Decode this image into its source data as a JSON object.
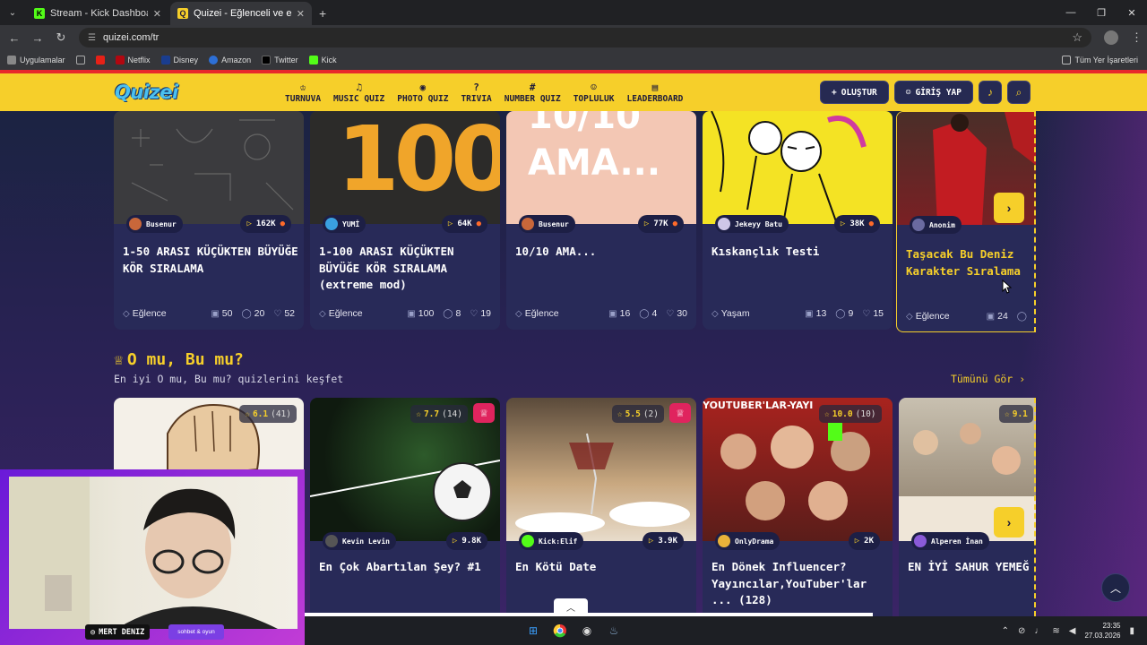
{
  "browser": {
    "tabs": [
      {
        "title": "Stream - Kick Dashboard",
        "active": false
      },
      {
        "title": "Quizei - Eğlenceli ve etkileşimli",
        "active": true
      }
    ],
    "url": "quizei.com/tr",
    "bookmarks": [
      "Uygulamalar",
      "Netflix",
      "Disney",
      "Amazon",
      "Twitter",
      "Kick"
    ],
    "bookmarks_right": "Tüm Yer İşaretleri"
  },
  "site": {
    "logo": "Quizei",
    "nav": [
      {
        "label": "TURNUVA",
        "icon": "trophy-icon",
        "glyph": "♔"
      },
      {
        "label": "MUSIC QUIZ",
        "icon": "music-icon",
        "glyph": "♫"
      },
      {
        "label": "PHOTO QUIZ",
        "icon": "camera-icon",
        "glyph": "◉"
      },
      {
        "label": "TRIVIA",
        "icon": "question-icon",
        "glyph": "?"
      },
      {
        "label": "NUMBER QUIZ",
        "icon": "hash-icon",
        "glyph": "#"
      },
      {
        "label": "TOPLULUK",
        "icon": "users-icon",
        "glyph": "☺"
      },
      {
        "label": "LEADERBOARD",
        "icon": "chart-icon",
        "glyph": "▤"
      }
    ],
    "create_label": "OLUŞTUR",
    "login_label": "GİRİŞ YAP"
  },
  "row1": [
    {
      "author": "Busenur",
      "plays": "162K",
      "title": "1-50 ARASI KÜÇÜKTEN BÜYÜĞE KÖR SIRALAMA",
      "category": "Eğlence",
      "questions": "50",
      "comments": "20",
      "likes": "52"
    },
    {
      "author": "YUMİ",
      "plays": "64K",
      "title": "1-100 ARASI KÜÇÜKTEN BÜYÜĞE KÖR SIRALAMA (extreme mod)",
      "category": "Eğlence",
      "questions": "100",
      "comments": "8",
      "likes": "19",
      "thumb_text": "100"
    },
    {
      "author": "Busenur",
      "plays": "77K",
      "title": "10/10 AMA...",
      "category": "Eğlence",
      "questions": "16",
      "comments": "4",
      "likes": "30",
      "thumb_text": "10/10 AMA..."
    },
    {
      "author": "Jekeyy Batu",
      "plays": "38K",
      "title": "Kıskançlık Testi",
      "category": "Yaşam",
      "questions": "13",
      "comments": "9",
      "likes": "15"
    },
    {
      "author": "Anonim",
      "title": "Taşacak Bu Deniz Karakter Sıralama",
      "category": "Eğlence",
      "questions": "24"
    }
  ],
  "section": {
    "title": "O mu, Bu mu?",
    "subtitle": "En iyi O mu, Bu mu? quizlerini keşfet",
    "see_all": "Tümünü Gör"
  },
  "row2": [
    {
      "rating": "6.1",
      "count": "(41)",
      "author": "",
      "plays": "",
      "title": ""
    },
    {
      "rating": "7.7",
      "count": "(14)",
      "author": "Kevin Levin",
      "plays": "9.8K",
      "title": "En Çok Abartılan Şey? #1"
    },
    {
      "rating": "5.5",
      "count": "(2)",
      "author": "Kick:Elif",
      "plays": "3.9K",
      "title": "En Kötü Date"
    },
    {
      "rating": "10.0",
      "count": "(10)",
      "author": "OnlyDrama",
      "plays": "2K",
      "title": "En Dönek Influencer? Yayıncılar,YouTuber'lar ... (128)",
      "thumb_text": "YOUTUBER'LAR-YAYI"
    },
    {
      "rating": "9.1",
      "author": "Alperen İnan",
      "title": "EN İYİ SAHUR YEMEĞ"
    }
  ],
  "overlay": {
    "streamer": "MERT DENIZ",
    "tag": "sohbet & oyun"
  },
  "taskbar": {
    "time": "23:35",
    "date": "27.03.2026"
  },
  "colors": {
    "accent": "#f6cf2a",
    "header_bg": "#f6cf2a",
    "card_bg": "#282a58",
    "crown": "#e0245e"
  }
}
